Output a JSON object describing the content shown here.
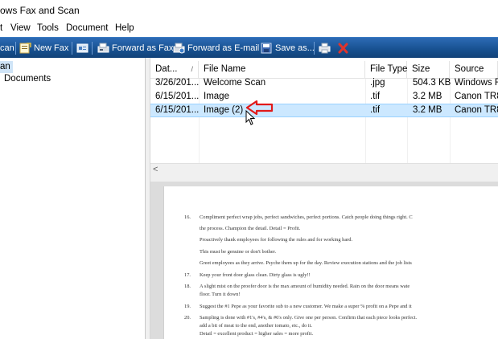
{
  "window": {
    "title": "ows Fax and Scan"
  },
  "menu": [
    "t",
    "View",
    "Tools",
    "Document",
    "Help"
  ],
  "toolbar": {
    "scan_label": "can",
    "new_fax_label": "New Fax",
    "forward_fax_label": "Forward as Fax",
    "forward_email_label": "Forward as E-mail",
    "save_as_label": "Save as..."
  },
  "tree": {
    "scan_node": "an",
    "documents_node": "Documents"
  },
  "list": {
    "columns": [
      "Dat...",
      "File Name",
      "File Type",
      "Size",
      "Source"
    ],
    "sort_glyph": "/",
    "rows": [
      {
        "date": "3/26/201...",
        "name": "Welcome Scan",
        "type": ".jpg",
        "size": "504.3 KB",
        "source": "Windows Fa"
      },
      {
        "date": "6/15/201...",
        "name": "Image",
        "type": ".tif",
        "size": "3.2 MB",
        "source": "Canon TR85"
      },
      {
        "date": "6/15/201...",
        "name": "Image (2)",
        "type": ".tif",
        "size": "3.2 MB",
        "source": "Canon TR85"
      }
    ],
    "selected_row": 2
  },
  "scroll": {
    "left_arrow": "<"
  },
  "preview": {
    "lines": [
      {
        "num": "16.",
        "text": "Compliment perfect wrap jobs, perfect sandwiches, perfect portions. Catch people doing things right. C"
      },
      {
        "num": "",
        "text": "the process. Champion the detail. Detail = Profit."
      },
      {
        "num": "",
        "text": "Proactively thank employees for following the rules and for working hard."
      },
      {
        "num": "",
        "text": "This must be genuine or don't bother."
      },
      {
        "num": "",
        "text": "Greet employees as they arrive. Psyche them up for the day. Review execution stations and the job lists"
      },
      {
        "num": "17.",
        "text": "Keep your front door glass clean. Dirty glass is ugly!!"
      },
      {
        "num": "18.",
        "text": "A slight mist on the proofer door is the max amount of humidity needed. Rain on the door means wate"
      },
      {
        "num": "",
        "text": "floor. Turn it down!"
      },
      {
        "num": "19.",
        "text": "Suggest the #1 Pepe as your favorite sub to a new customer. We make a super % profit on a Pepe and it"
      },
      {
        "num": "20.",
        "text": "Sampling is done with #1's, #4's, & #6's only. Give one per person. Confirm that each piece looks perfect."
      },
      {
        "num": "",
        "text": "add a bit of meat to the end, another tomato, etc., do it."
      },
      {
        "num": "",
        "text": "Detail = excellent product = higher sales = more profit."
      }
    ]
  },
  "colors": {
    "toolbar": "#17508f",
    "selection": "#cce8ff",
    "annotation": "#e11a1a"
  },
  "icons": [
    "scan-icon",
    "new-fax-icon",
    "contacts-icon",
    "forward-fax-icon",
    "forward-email-icon",
    "save-icon",
    "print-icon",
    "delete-icon",
    "red-arrow-icon",
    "mouse-cursor-icon"
  ]
}
